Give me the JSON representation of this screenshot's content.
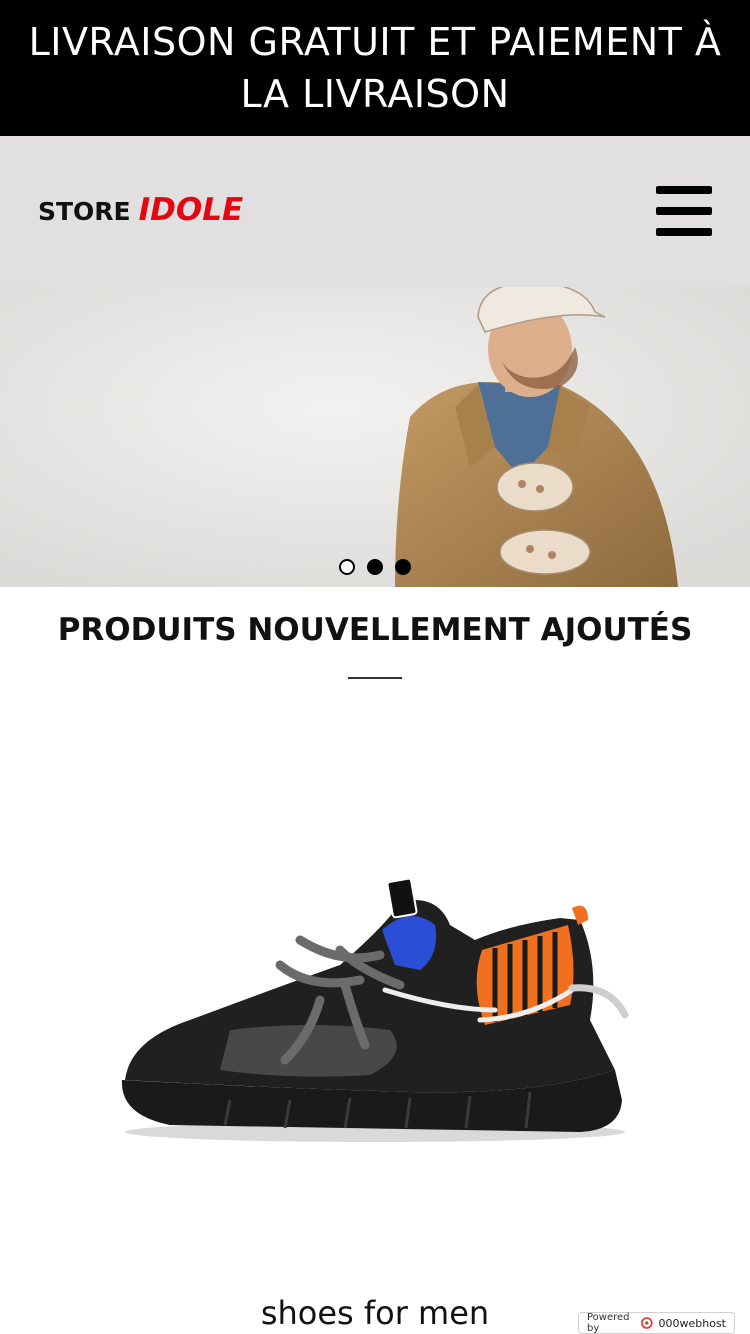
{
  "promo": {
    "text": "LIVRAISON GRATUIT ET PAIEMENT À LA LIVRAISON"
  },
  "header": {
    "logo_word": "STORE",
    "logo_brand": "IDOLE",
    "menu_icon": "hamburger-menu-icon",
    "brand_color": "#e30613"
  },
  "hero": {
    "slide_count": 3,
    "active_slide": 1,
    "image": "man-in-cap-and-gloves"
  },
  "section": {
    "title": "PRODUITS NOUVELLEMENT AJOUTÉS"
  },
  "products": [
    {
      "name": "shoes for men",
      "image": "black-sneaker"
    }
  ],
  "footer_badge": {
    "prefix": "Powered by",
    "brand": "000webhost"
  }
}
